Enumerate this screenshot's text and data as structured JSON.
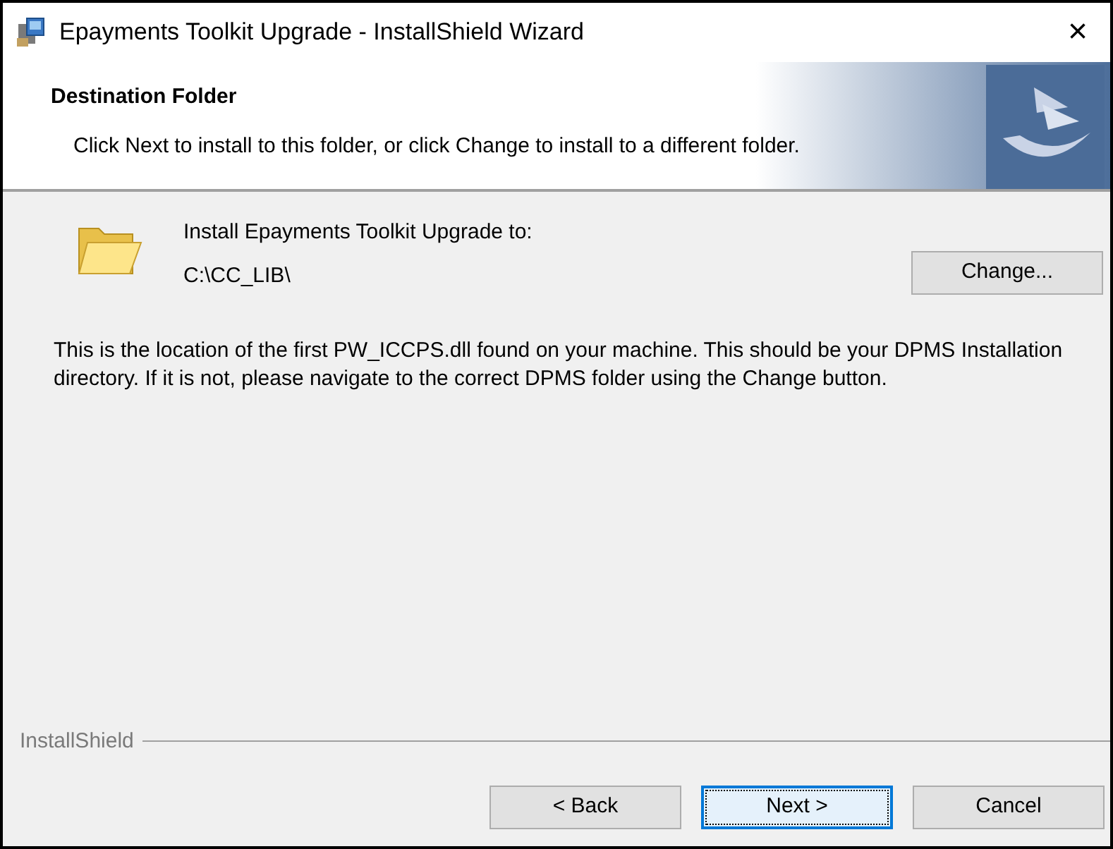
{
  "window": {
    "title": "Epayments Toolkit Upgrade - InstallShield Wizard",
    "close": "×"
  },
  "header": {
    "title": "Destination Folder",
    "subtitle": "Click Next to install to this folder, or click Change to install to a different folder."
  },
  "destination": {
    "label": "Install Epayments Toolkit Upgrade to:",
    "path": "C:\\CC_LIB\\",
    "button": "Change..."
  },
  "note": "This is the location of the first PW_ICCPS.dll found on your machine. This should be your DPMS Installation directory. If it is not, please navigate to the correct DPMS folder using the Change button.",
  "footer": {
    "brand": "InstallShield",
    "buttons": [
      {
        "label": "< Back",
        "focused": false
      },
      {
        "label": "Next >",
        "focused": true
      },
      {
        "label": "Cancel",
        "focused": false
      }
    ]
  }
}
